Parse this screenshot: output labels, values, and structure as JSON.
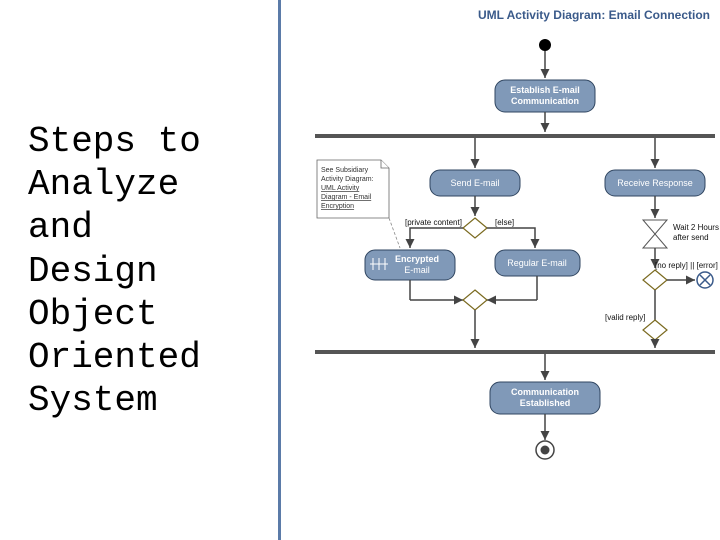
{
  "left": {
    "title_l1": "Steps to",
    "title_l2": "Analyze",
    "title_l3": "and",
    "title_l4": "Design",
    "title_l5": "Object",
    "title_l6": "Oriented",
    "title_l7": "System"
  },
  "diagram": {
    "title": "UML Activity Diagram: Email Connection",
    "nodes": {
      "establish_l1": "Establish E-mail",
      "establish_l2": "Communication",
      "send": "Send E-mail",
      "receive": "Receive Response",
      "encrypted_l1": "Encrypted",
      "encrypted_l2": "E-mail",
      "regular": "Regular E-mail",
      "commEstablished_l1": "Communication",
      "commEstablished_l2": "Established"
    },
    "guards": {
      "private": "[private content]",
      "else": "[else]",
      "valid": "[valid reply]",
      "noreply": "[no reply]  || [error]"
    },
    "note": {
      "l1": "See Subsidiary",
      "l2": "Activity Diagram:",
      "l3": "UML Activity",
      "l4": "Diagram - Email",
      "l5": "Encryption"
    },
    "wait_l1": "Wait 2 Hours",
    "wait_l2": "after send"
  }
}
